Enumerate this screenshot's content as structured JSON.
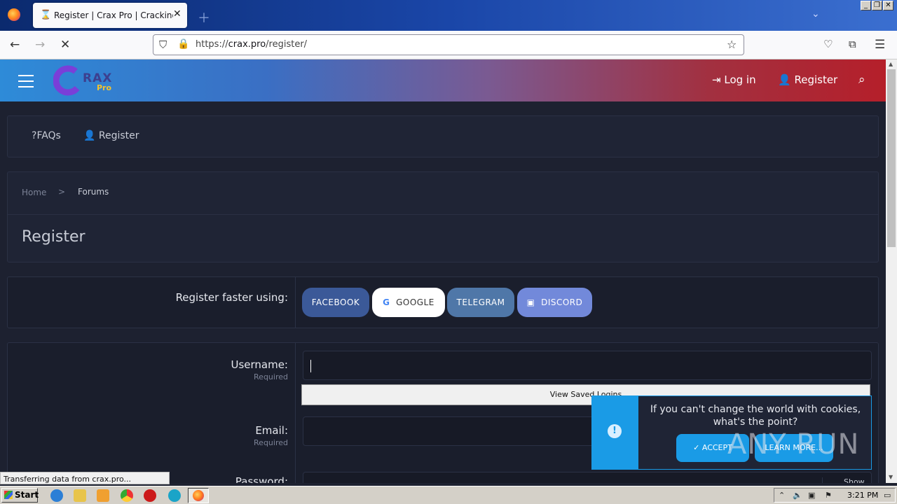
{
  "browser": {
    "tab_title": "Register | Crax Pro | Cracking, Spa",
    "url_prefix": "https://",
    "url_host": "crax.pro",
    "url_path": "/register/"
  },
  "site": {
    "logo_text": "RAX",
    "logo_sub": "Pro",
    "login_label": "Log in",
    "register_label": "Register"
  },
  "subnav": {
    "faqs_label": "FAQs",
    "register_label": "Register"
  },
  "breadcrumb": {
    "home": "Home",
    "separator": ">",
    "forums": "Forums"
  },
  "page_title": "Register",
  "register_faster": {
    "label": "Register faster using:",
    "buttons": [
      {
        "label": "FACEBOOK",
        "color": "#3b5998"
      },
      {
        "label": "GOOGLE",
        "color": "#ffffff"
      },
      {
        "label": "TELEGRAM",
        "color": "#4f77a8"
      },
      {
        "label": "DISCORD",
        "color": "#7289da"
      }
    ]
  },
  "form": {
    "username_label": "Username:",
    "username_req": "Required",
    "email_label": "Email:",
    "email_req": "Required",
    "password_label": "Password:",
    "show_label": "Show"
  },
  "autofill": {
    "label": "View Saved Logins"
  },
  "cookie": {
    "message": "If you can't change the world with cookies, what's the point?",
    "accept": "ACCEPT",
    "learn_more": "LEARN MORE..."
  },
  "watermark": "ANY RUN",
  "status_bar": "Transferring data from crax.pro...",
  "taskbar": {
    "start_label": "Start",
    "clock": "3:21 PM"
  },
  "colors": {
    "accent": "#1a9be6",
    "header_left": "#2e8bd8",
    "header_right": "#b51f2a"
  }
}
